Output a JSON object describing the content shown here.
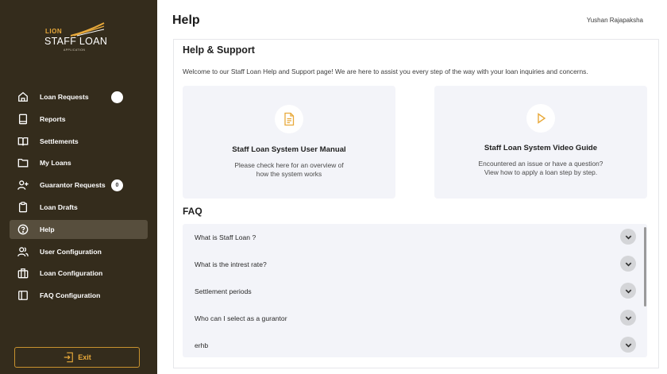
{
  "app": {
    "logo": {
      "top": "LION",
      "brand": "STAFF LOAN",
      "sub": "APPLICATION"
    },
    "user_name": "Yushan Rajapaksha",
    "page_title": "Help"
  },
  "colors": {
    "sidebar": "#342c1c",
    "sidebar_active": "#574e3d",
    "accent": "#e8a93a",
    "card_bg": "#f3f4f9"
  },
  "sidebar": {
    "items": [
      {
        "label": "Loan Requests",
        "icon": "home-icon"
      },
      {
        "label": "Reports",
        "icon": "book-icon"
      },
      {
        "label": "Settlements",
        "icon": "open-book-icon"
      },
      {
        "label": "My Loans",
        "icon": "folder-icon"
      },
      {
        "label": "Guarantor Requests",
        "icon": "add-user-icon",
        "badge": "0"
      },
      {
        "label": "Loan Drafts",
        "icon": "clipboard-icon"
      },
      {
        "label": "Help",
        "icon": "help-circle-icon",
        "active": true
      },
      {
        "label": "User Configuration",
        "icon": "users-icon"
      },
      {
        "label": "Loan Configuration",
        "icon": "briefcase-icon"
      },
      {
        "label": "FAQ Configuration",
        "icon": "sidebar-panel-icon"
      }
    ],
    "exit_label": "Exit"
  },
  "help": {
    "title": "Help & Support",
    "welcome": "Welcome to our Staff Loan Help and Support page! We are here to assist you every step of the way with your loan inquiries and concerns.",
    "cards": [
      {
        "title": "Staff Loan System User Manual",
        "line1": "Please check here for an overview of",
        "line2": "how the system works",
        "icon": "document-icon"
      },
      {
        "title": "Staff Loan System Video Guide",
        "line1": "Encountered an issue or have a question?",
        "line2": "View how to apply a loan step by step.",
        "icon": "play-icon"
      }
    ]
  },
  "faq": {
    "title": "FAQ",
    "items": [
      {
        "question": "What is Staff Loan ?"
      },
      {
        "question": "What is the intrest rate?"
      },
      {
        "question": "Settlement periods"
      },
      {
        "question": "Who can I select as a gurantor"
      },
      {
        "question": "erhb"
      }
    ]
  }
}
